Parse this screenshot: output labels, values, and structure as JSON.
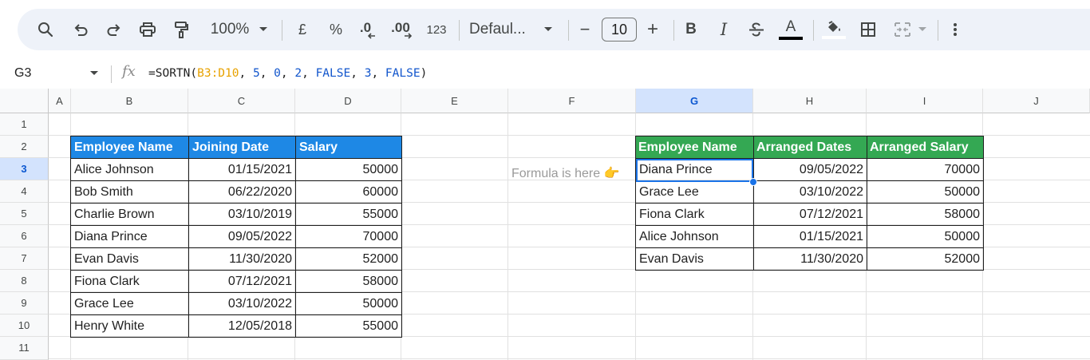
{
  "toolbar": {
    "zoom": "100%",
    "currency_symbol": "£",
    "percent_symbol": "%",
    "decrease_decimal": ".0",
    "increase_decimal": ".00",
    "more_formats": "123",
    "font_name": "Defaul...",
    "font_size": "10",
    "minus": "−",
    "plus": "+",
    "bold": "B",
    "italic": "I",
    "text_color_glyph": "A",
    "icons": [
      "search-icon",
      "undo-icon",
      "redo-icon",
      "print-icon",
      "paint-format-icon",
      "chevron-down-icon",
      "decrease-decimal-icon",
      "increase-decimal-icon",
      "strikethrough-icon",
      "text-color-icon",
      "fill-color-icon",
      "borders-icon",
      "merge-cells-icon",
      "more-vert-icon"
    ]
  },
  "formula_bar": {
    "cell_ref": "G3",
    "fx": "fx",
    "formula_parts": {
      "prefix": "=SORTN(",
      "range": "B3:D10",
      "sep1": ", ",
      "n": "5",
      "sep2": ", ",
      "ties": "0",
      "sep3": ", ",
      "sort_col1": "2",
      "sep4": ", ",
      "asc1": "FALSE",
      "sep5": ", ",
      "sort_col2": "3",
      "sep6": ", ",
      "asc2": "FALSE",
      "suffix": ")"
    }
  },
  "columns": [
    "A",
    "B",
    "C",
    "D",
    "E",
    "F",
    "G",
    "H",
    "I",
    "J"
  ],
  "rows": [
    "1",
    "2",
    "3",
    "4",
    "5",
    "6",
    "7",
    "8",
    "9",
    "10",
    "11"
  ],
  "selected_column": "G",
  "selected_row": "3",
  "source_table": {
    "headers": [
      "Employee Name",
      "Joining Date",
      "Salary"
    ],
    "rows": [
      [
        "Alice Johnson",
        "01/15/2021",
        "50000"
      ],
      [
        "Bob Smith",
        "06/22/2020",
        "60000"
      ],
      [
        "Charlie Brown",
        "03/10/2019",
        "55000"
      ],
      [
        "Diana Prince",
        "09/05/2022",
        "70000"
      ],
      [
        "Evan Davis",
        "11/30/2020",
        "52000"
      ],
      [
        "Fiona Clark",
        "07/12/2021",
        "58000"
      ],
      [
        "Grace Lee",
        "03/10/2022",
        "50000"
      ],
      [
        "Henry White",
        "12/05/2018",
        "55000"
      ]
    ]
  },
  "result_table": {
    "headers": [
      "Employee Name",
      "Arranged Dates",
      "Arranged Salary"
    ],
    "rows": [
      [
        "Diana Prince",
        "09/05/2022",
        "70000"
      ],
      [
        "Grace Lee",
        "03/10/2022",
        "50000"
      ],
      [
        "Fiona Clark",
        "07/12/2021",
        "58000"
      ],
      [
        "Alice Johnson",
        "01/15/2021",
        "50000"
      ],
      [
        "Evan Davis",
        "11/30/2020",
        "52000"
      ]
    ]
  },
  "note": "Formula is here 👉",
  "colors": {
    "source_header": "#1e88e5",
    "result_header": "#34a853",
    "selection": "#1a73e8",
    "toolbar_bg": "#eef2f9"
  }
}
